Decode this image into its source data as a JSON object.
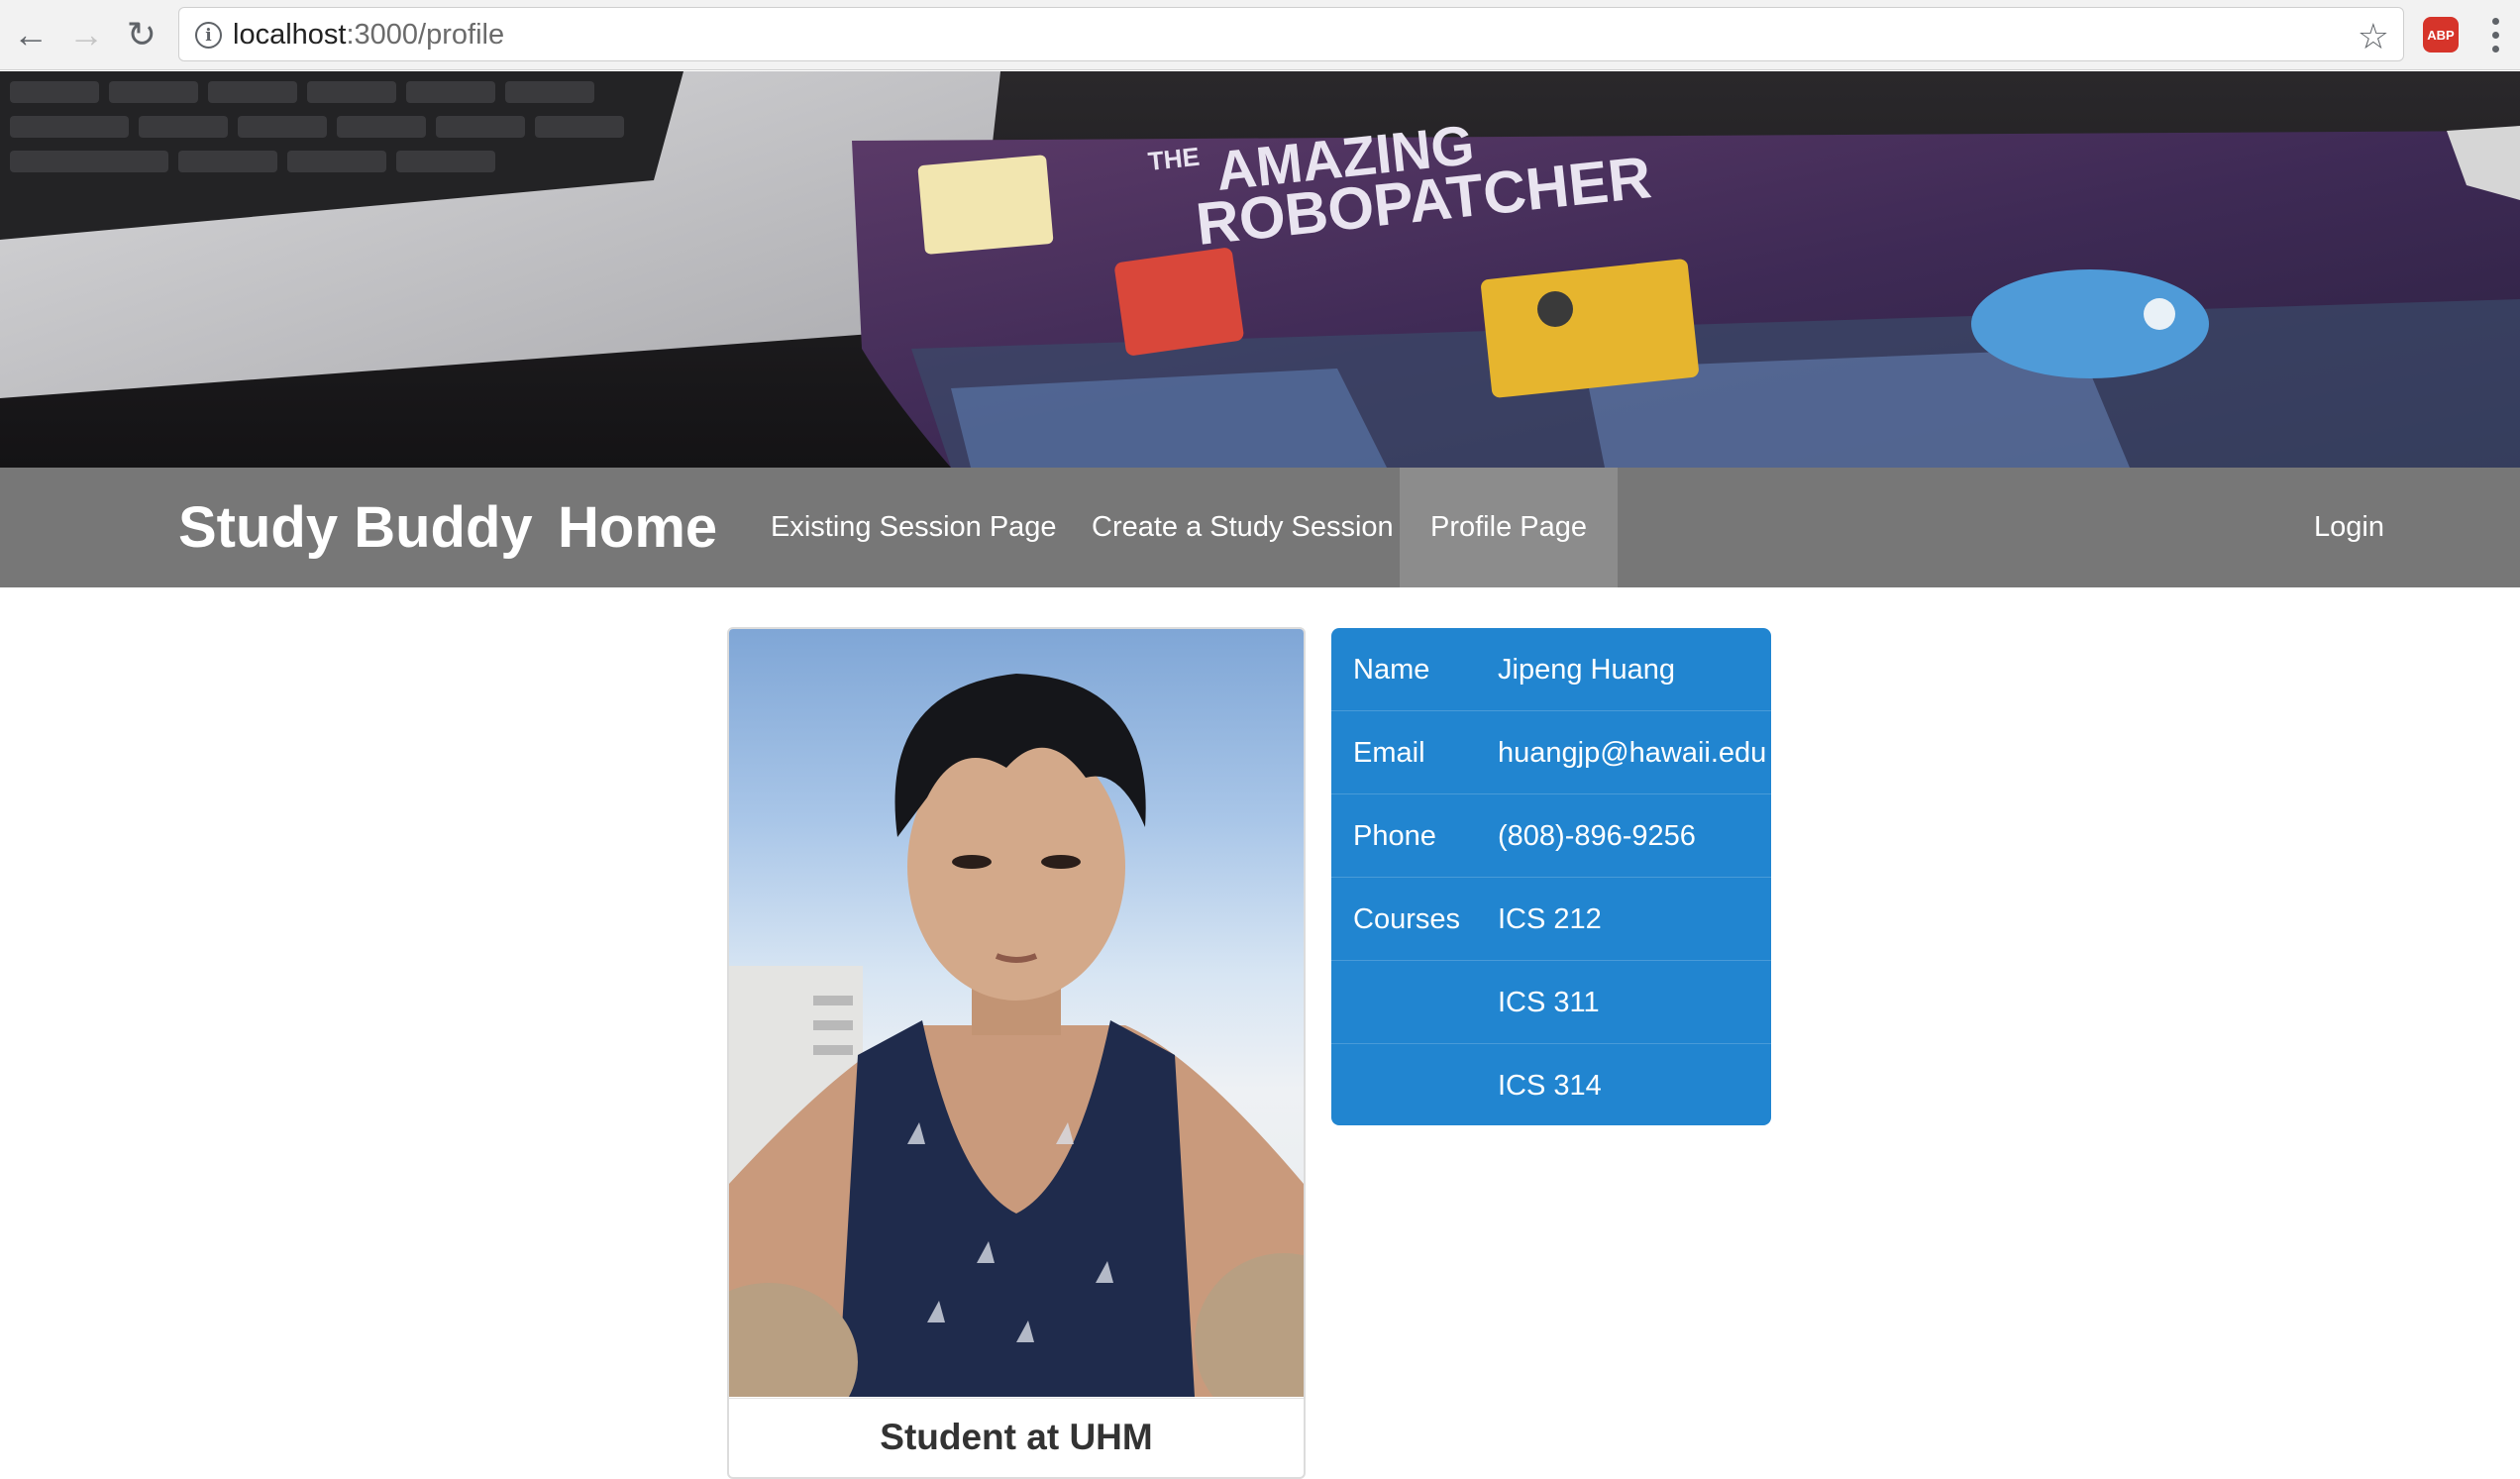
{
  "browser": {
    "url_host": "localhost",
    "url_path": ":3000/profile",
    "extension_label": "ABP",
    "back_icon": "arrow-left-icon",
    "forward_icon": "arrow-right-icon",
    "reload_icon": "reload-icon",
    "bookmark_icon": "star-icon"
  },
  "banner": {
    "book_title_line1": "THE",
    "book_title_line2": "AMAZING",
    "book_title_line3": "ROBOPATCHER"
  },
  "navbar": {
    "brand": "Study Buddy",
    "home": "Home",
    "links": [
      "Existing Session Page",
      "Create a Study Session",
      "Profile Page"
    ],
    "active_link": "Profile Page",
    "login": "Login"
  },
  "profile": {
    "caption": "Student at UHM",
    "rows": [
      {
        "label": "Name",
        "value": "Jipeng Huang"
      },
      {
        "label": "Email",
        "value": "huangjp@hawaii.edu"
      },
      {
        "label": "Phone",
        "value": "(808)-896-9256"
      },
      {
        "label": "Courses",
        "value": "ICS 212"
      },
      {
        "label": "",
        "value": "ICS 311"
      },
      {
        "label": "",
        "value": "ICS 314"
      }
    ]
  },
  "colors": {
    "navbar": "#777777",
    "navbar_active": "#8c8c8c",
    "info_table": "#2185d0"
  }
}
